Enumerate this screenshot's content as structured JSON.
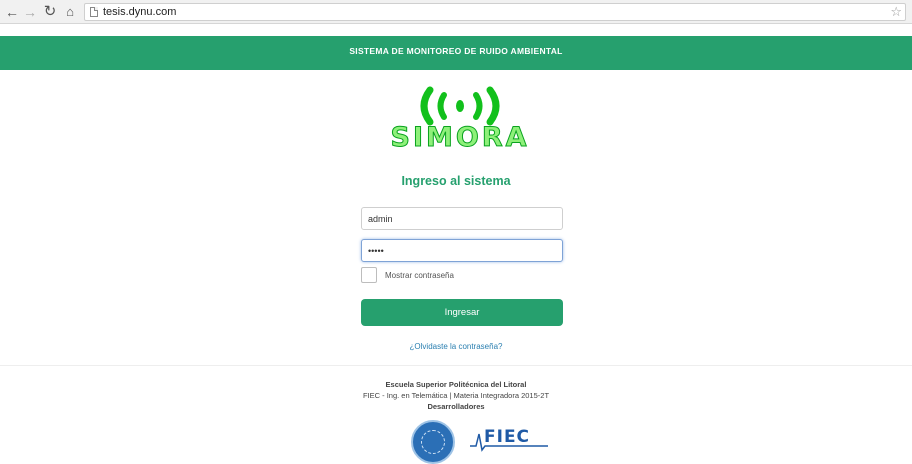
{
  "browser": {
    "url": "tesis.dynu.com",
    "icons": [
      "back-arrow-icon",
      "forward-arrow-icon",
      "reload-icon",
      "home-icon",
      "page-icon",
      "bookmark-star-icon"
    ]
  },
  "header": {
    "title": "SISTEMA DE MONITOREO DE RUIDO AMBIENTAL",
    "bg_color": "#26a06e"
  },
  "logo": {
    "text": "SIMORA",
    "signal_color": "#11c21a"
  },
  "login": {
    "title": "Ingreso al sistema",
    "username_value": "admin",
    "password_value": "•••••",
    "show_password_label": "Mostrar contraseña",
    "show_password_checked": false,
    "submit_label": "Ingresar",
    "forgot_label": "¿Olvidaste la contraseña?"
  },
  "footer": {
    "institution": "Escuela Superior Politécnica del Litoral",
    "program": "FIEC - Ing. en Telemática | Materia Integradora 2015-2T",
    "developers": "Desarrolladores",
    "logo_fiec": "FIEC"
  }
}
